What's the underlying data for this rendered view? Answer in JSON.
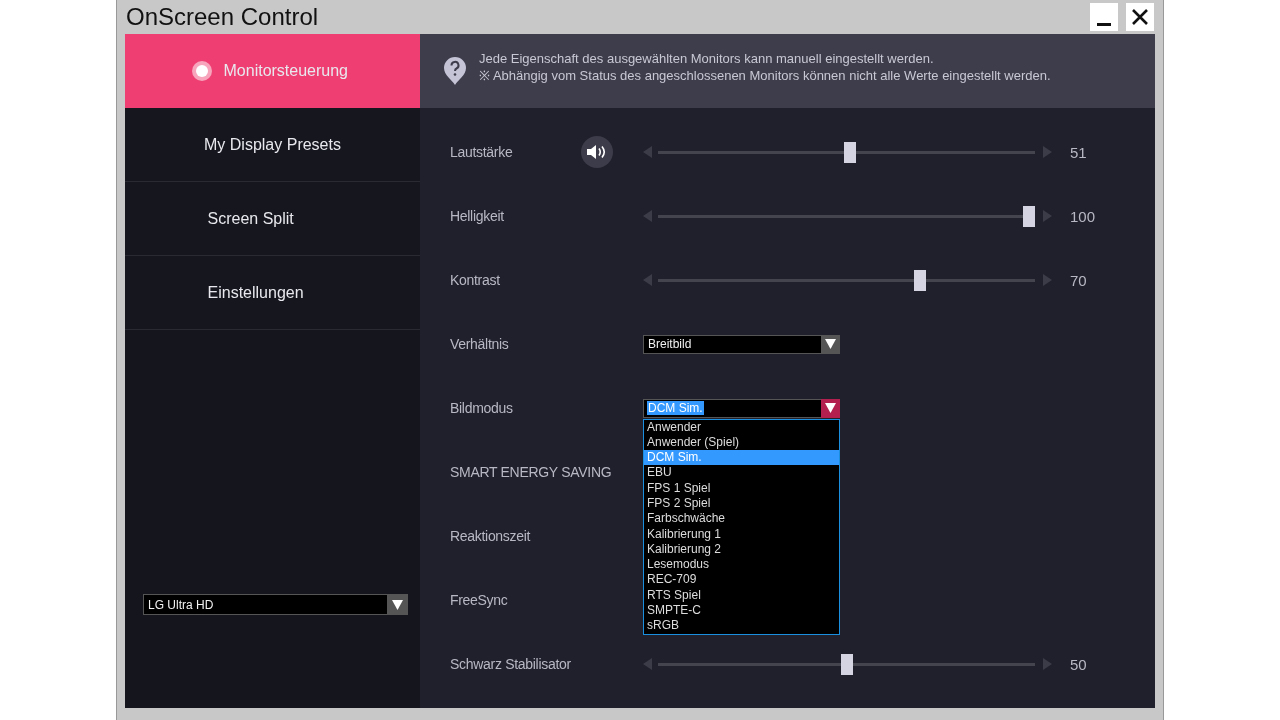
{
  "window": {
    "title": "OnScreen Control"
  },
  "sidebar": {
    "items": [
      {
        "label": "Monitorsteuerung",
        "selected": true
      },
      {
        "label": "My Display Presets",
        "selected": false
      },
      {
        "label": "Screen Split",
        "selected": false
      },
      {
        "label": "Einstellungen",
        "selected": false
      }
    ],
    "monitor_select": {
      "value": "LG Ultra HD"
    }
  },
  "info": {
    "lines": [
      "Jede Eigenschaft des ausgewählten Monitors kann manuell eingestellt werden.",
      "※ Abhängig vom Status des angeschlossenen Monitors können nicht alle Werte eingestellt werden."
    ]
  },
  "settings": [
    {
      "kind": "volume_slider",
      "label": "Lautstärke",
      "level": 0.51,
      "reading": "51"
    },
    {
      "kind": "slider",
      "label": "Helligkeit",
      "level": 1.0,
      "reading": "100"
    },
    {
      "kind": "slider",
      "label": "Kontrast",
      "level": 0.7,
      "reading": "70"
    },
    {
      "kind": "select",
      "label": "Verhältnis",
      "value": "Breitbild",
      "open": false
    },
    {
      "kind": "select",
      "label": "Bildmodus",
      "value": "DCM Sim.",
      "open": true,
      "options": [
        {
          "label": "Anwender",
          "selected": false
        },
        {
          "label": "Anwender (Spiel)",
          "selected": false
        },
        {
          "label": "DCM Sim.",
          "selected": true
        },
        {
          "label": "EBU",
          "selected": false
        },
        {
          "label": "FPS 1 Spiel",
          "selected": false
        },
        {
          "label": "FPS 2 Spiel",
          "selected": false
        },
        {
          "label": "Farbschwäche",
          "selected": false
        },
        {
          "label": "Kalibrierung 1",
          "selected": false
        },
        {
          "label": "Kalibrierung 2",
          "selected": false
        },
        {
          "label": "Lesemodus",
          "selected": false
        },
        {
          "label": "REC-709",
          "selected": false
        },
        {
          "label": "RTS Spiel",
          "selected": false
        },
        {
          "label": "SMPTE-C",
          "selected": false
        },
        {
          "label": "sRGB",
          "selected": false
        }
      ]
    },
    {
      "kind": "label",
      "label": "SMART ENERGY SAVING"
    },
    {
      "kind": "label",
      "label": "Reaktionszeit"
    },
    {
      "kind": "label",
      "label": "FreeSync"
    },
    {
      "kind": "slider",
      "label": "Schwarz Stabilisator",
      "level": 0.5,
      "reading": "50"
    }
  ]
}
